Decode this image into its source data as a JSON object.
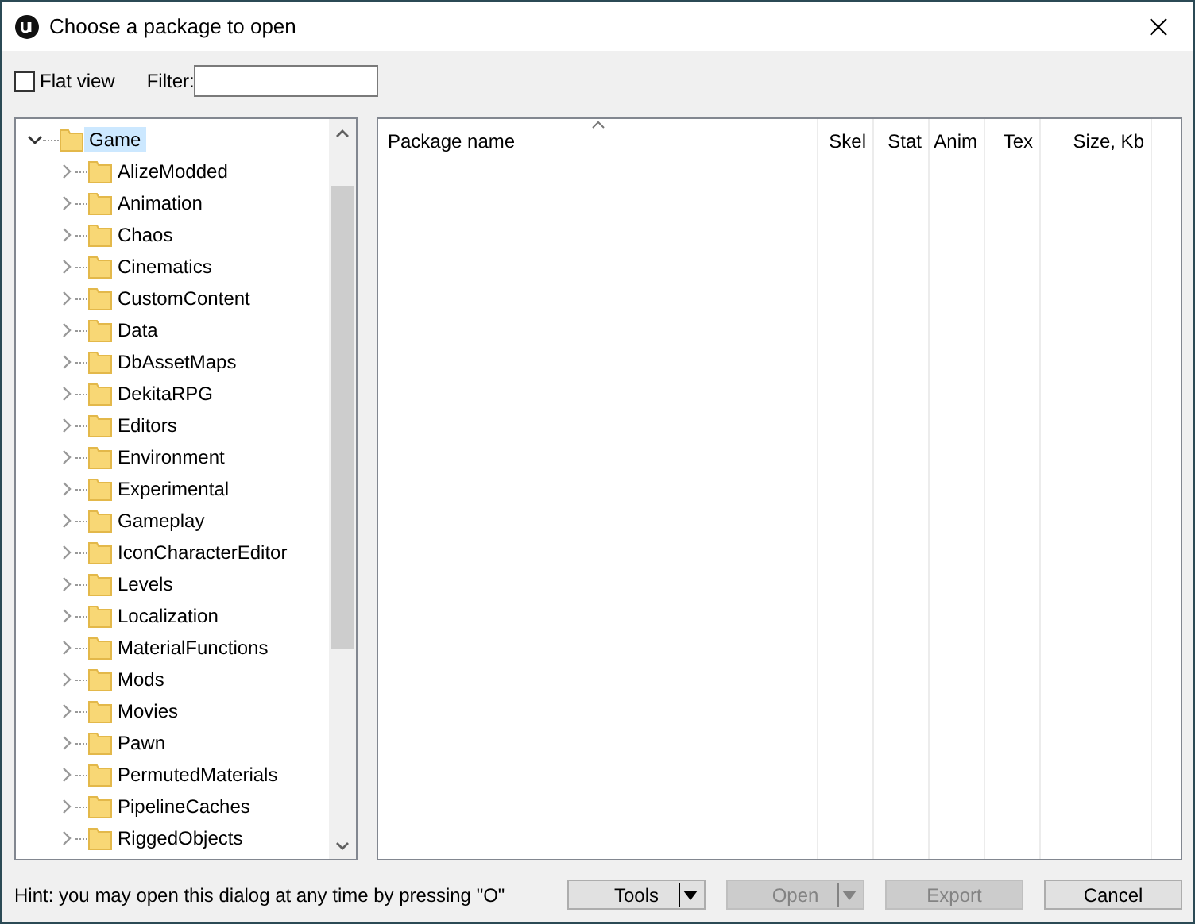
{
  "window": {
    "title": "Choose a package to open"
  },
  "toolbar": {
    "flat_view": {
      "label": "Flat view",
      "checked": false
    },
    "filter": {
      "label": "Filter:"
    }
  },
  "tree": {
    "label": "Game",
    "expanded": true,
    "selected": true,
    "children": [
      {
        "label": "AlizeModded",
        "expanded": false
      },
      {
        "label": "Animation",
        "expanded": false
      },
      {
        "label": "Chaos",
        "expanded": false
      },
      {
        "label": "Cinematics",
        "expanded": false
      },
      {
        "label": "CustomContent",
        "expanded": false
      },
      {
        "label": "Data",
        "expanded": false
      },
      {
        "label": "DbAssetMaps",
        "expanded": false
      },
      {
        "label": "DekitaRPG",
        "expanded": false
      },
      {
        "label": "Editors",
        "expanded": false
      },
      {
        "label": "Environment",
        "expanded": false
      },
      {
        "label": "Experimental",
        "expanded": false
      },
      {
        "label": "Gameplay",
        "expanded": false
      },
      {
        "label": "IconCharacterEditor",
        "expanded": false
      },
      {
        "label": "Levels",
        "expanded": false
      },
      {
        "label": "Localization",
        "expanded": false
      },
      {
        "label": "MaterialFunctions",
        "expanded": false
      },
      {
        "label": "Mods",
        "expanded": false
      },
      {
        "label": "Movies",
        "expanded": false
      },
      {
        "label": "Pawn",
        "expanded": false
      },
      {
        "label": "PermutedMaterials",
        "expanded": false
      },
      {
        "label": "PipelineCaches",
        "expanded": false
      },
      {
        "label": "RiggedObjects",
        "expanded": false
      }
    ]
  },
  "table": {
    "columns": [
      {
        "label": "Package name",
        "kind": "text",
        "sorted": true
      },
      {
        "label": "Skel",
        "kind": "number",
        "sorted": false
      },
      {
        "label": "Stat",
        "kind": "number",
        "sorted": false
      },
      {
        "label": "Anim",
        "kind": "number",
        "sorted": false
      },
      {
        "label": "Tex",
        "kind": "number",
        "sorted": false
      },
      {
        "label": "Size, Kb",
        "kind": "number",
        "sorted": false
      }
    ]
  },
  "status_bar": {
    "hint": "Hint: you may open this dialog at any time by pressing \"O\""
  },
  "buttons": [
    {
      "label": "Tools",
      "dropdown": true,
      "disabled": false
    },
    {
      "label": "Open",
      "dropdown": true,
      "disabled": true
    },
    {
      "label": "Export",
      "dropdown": false,
      "disabled": true
    },
    {
      "label": "Cancel",
      "dropdown": false,
      "disabled": false
    }
  ]
}
